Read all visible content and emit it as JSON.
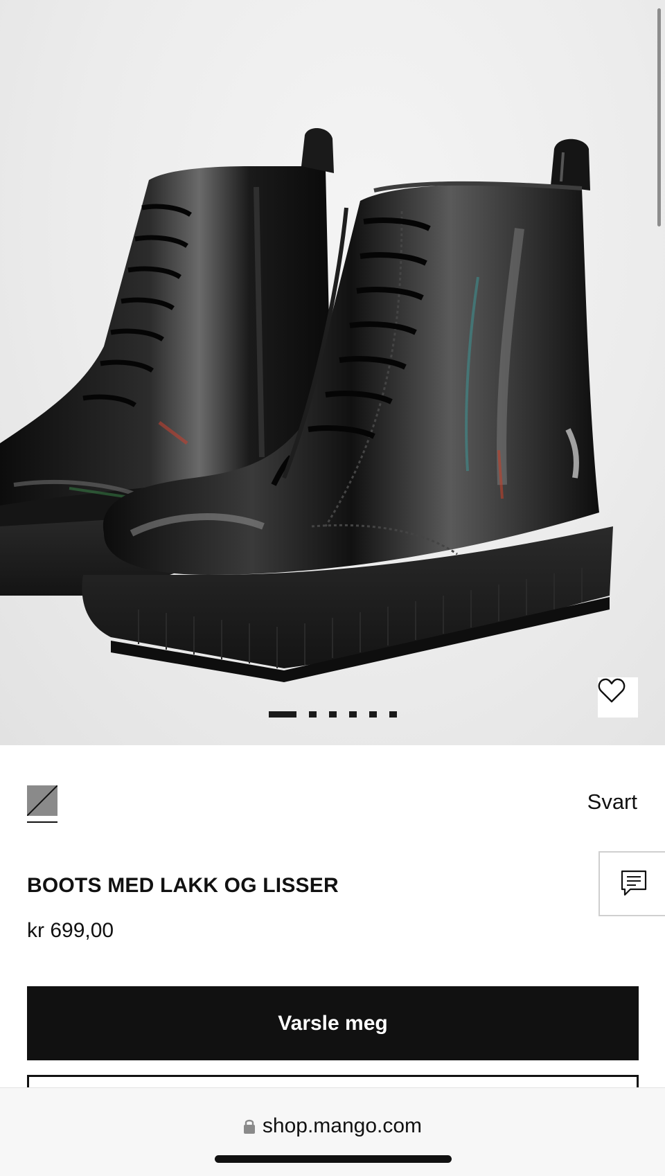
{
  "product": {
    "image_alt": "product-photo-black-patent-lace-up-boots",
    "image_count": 6,
    "active_image_index": 0,
    "color": {
      "name": "Svart",
      "swatch_hex": "#8a8a8a"
    },
    "title": "BOOTS MED LAKK OG LISSER",
    "price": "kr 699,00"
  },
  "actions": {
    "notify_label": "Varsle meg",
    "favorite_icon": "heart-icon",
    "chat_icon": "chat-icon"
  },
  "browser": {
    "url": "shop.mango.com",
    "lock_icon": "lock-icon"
  },
  "colors": {
    "primary_button_bg": "#111111",
    "primary_button_text": "#ffffff",
    "background": "#ffffff"
  }
}
